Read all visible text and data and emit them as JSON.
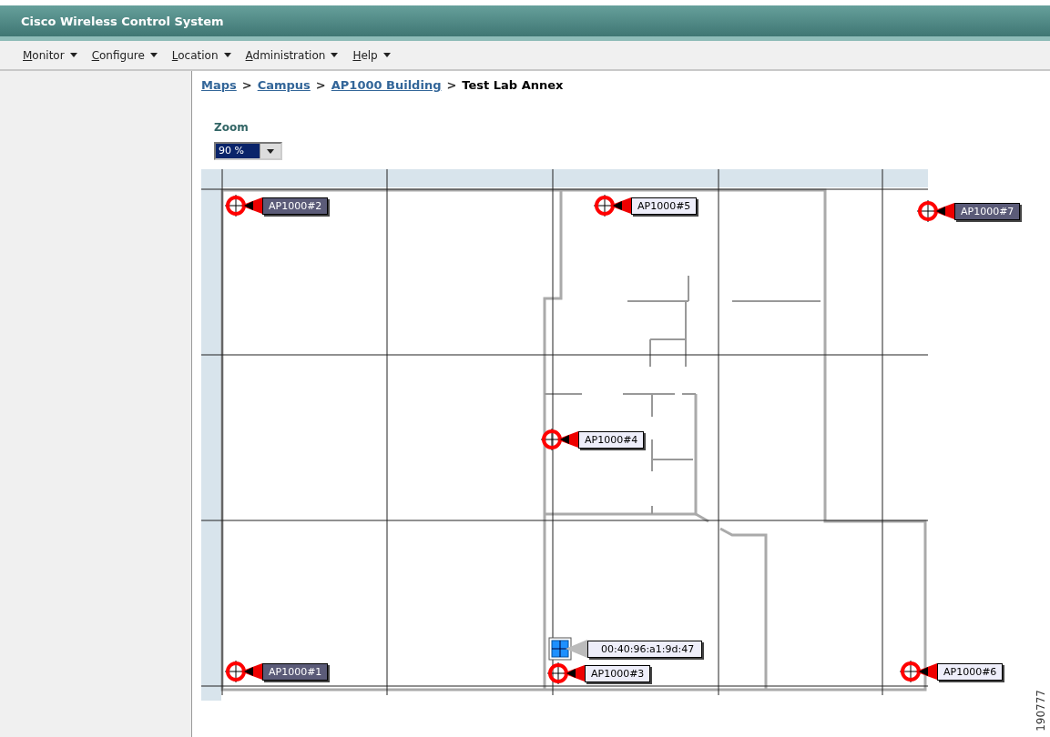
{
  "window": {
    "title": "Cisco Wireless Control System"
  },
  "menu": [
    {
      "label": "Monitor"
    },
    {
      "label": "Configure"
    },
    {
      "label": "Location"
    },
    {
      "label": "Administration"
    },
    {
      "label": "Help"
    }
  ],
  "breadcrumb": [
    {
      "kind": "link",
      "label": "Maps"
    },
    {
      "kind": "separator",
      "label": ">"
    },
    {
      "kind": "link",
      "label": "Campus"
    },
    {
      "kind": "separator",
      "label": ">"
    },
    {
      "kind": "link",
      "label": "AP1000 Building"
    },
    {
      "kind": "separator",
      "label": ">"
    },
    {
      "kind": "current",
      "label": "Test Lab Annex"
    }
  ],
  "zoom": {
    "label": "Zoom",
    "value": "90 %"
  },
  "map": {
    "access_points": [
      {
        "label": "AP1000#2",
        "kind": "dark"
      },
      {
        "label": "AP1000#5",
        "kind": "light"
      },
      {
        "label": "AP1000#7",
        "kind": "dark"
      },
      {
        "label": "AP1000#4",
        "kind": "light"
      },
      {
        "label": "AP1000#1",
        "kind": "dark"
      },
      {
        "label": "AP1000#3",
        "kind": "light"
      },
      {
        "label": "AP1000#6",
        "kind": "light"
      }
    ],
    "clients": [
      {
        "label": "00:40:96:a1:9d:47"
      }
    ]
  },
  "figure_id": "190777"
}
